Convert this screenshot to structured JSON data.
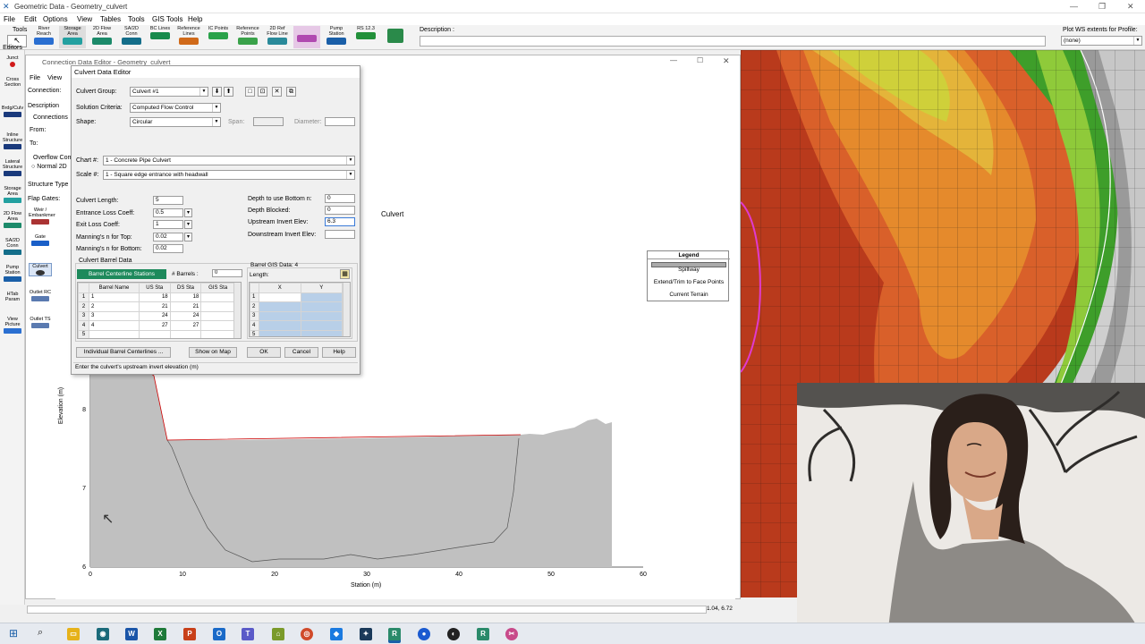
{
  "app": {
    "title": "Geometric Data - Geometry_culvert",
    "menu": [
      "File",
      "Edit",
      "Options",
      "View",
      "Tables",
      "Tools",
      "GIS Tools",
      "Help"
    ]
  },
  "toolbar": {
    "tools_label": "Tools",
    "buttons": [
      "River Reach",
      "Storage Area",
      "2D Flow Area",
      "SA/2D Conn",
      "BC Lines",
      "Reference Lines",
      "IC Points",
      "Reference Points",
      "2D Ref Flow Line",
      "Pump Station",
      "RS 12.3"
    ],
    "description_label": "Description :",
    "plot_ws_label": "Plot WS extents for Profile:",
    "plot_ws_value": "(none)"
  },
  "editors": {
    "label": "Editors",
    "items": [
      "Junct",
      "Cross Section",
      "Brdg/Culv",
      "Inline Structure",
      "Lateral Structure",
      "Storage Area",
      "2D Flow Area",
      "SA/2D Conn",
      "Pump Station",
      "HTab Param",
      "View Picture"
    ]
  },
  "connection_editor": {
    "title": "Connection Data Editor - Geometry_culvert",
    "menu": [
      "File",
      "View"
    ],
    "connection_label": "Connection:",
    "description_label": "Description",
    "connections_label": "Connections",
    "from_label": "From:",
    "to_label": "To:",
    "overflow_label": "Overflow Com",
    "normal_2d_label": "Normal 2D",
    "structure_type_label": "Structure Type",
    "flap_gates_label": "Flap Gates:",
    "side_buttons": [
      "Weir / Embankment",
      "Gate",
      "Culvert",
      "Outlet RC",
      "Outlet TS"
    ],
    "plot_title": "Culvert",
    "y_axis_label": "Elevation (m)",
    "x_axis_label": "Station (m)",
    "x_ticks": [
      "0",
      "10",
      "20",
      "30",
      "40",
      "50",
      "60"
    ],
    "y_ticks": [
      "8",
      "7",
      "6"
    ],
    "coords": "1.04, 6.72"
  },
  "legend": {
    "title": "Legend",
    "items": [
      "Spillway",
      "Extend/Trim to Face Points",
      "Current Terrain"
    ]
  },
  "culvert_dialog": {
    "title": "Culvert Data Editor",
    "culvert_group_label": "Culvert Group:",
    "culvert_group_value": "Culvert #1",
    "solution_criteria_label": "Solution Criteria:",
    "solution_criteria_value": "Computed Flow Control",
    "shape_label": "Shape:",
    "shape_value": "Circular",
    "span_label": "Span:",
    "diameter_label": "Diameter:",
    "chart_label": "Chart #:",
    "chart_value": "1 - Concrete Pipe Culvert",
    "scale_label": "Scale #:",
    "scale_value": "1 - Square edge entrance with headwall",
    "culvert_length_label": "Culvert Length:",
    "culvert_length_value": "5",
    "entrance_loss_label": "Entrance Loss Coeff:",
    "entrance_loss_value": "0.5",
    "exit_loss_label": "Exit Loss Coeff:",
    "exit_loss_value": "1",
    "manning_top_label": "Manning's n for Top:",
    "manning_top_value": "0.02",
    "manning_bottom_label": "Manning's n for Bottom:",
    "manning_bottom_value": "0.02",
    "depth_bottom_n_label": "Depth to use Bottom n:",
    "depth_bottom_n_value": "0",
    "depth_blocked_label": "Depth Blocked:",
    "depth_blocked_value": "0",
    "upstream_invert_label": "Upstream Invert Elev:",
    "upstream_invert_value": "6.3",
    "downstream_invert_label": "Downstream Invert Elev:",
    "downstream_invert_value": "",
    "barrel_data_label": "Culvert Barrel Data",
    "barrel_stations_tab": "Barrel Centerline Stations",
    "num_barrels_label": "# Barrels :",
    "num_barrels_value": "0",
    "barrel_columns": [
      "Barrel Name",
      "US Sta",
      "DS Sta",
      "GIS Sta"
    ],
    "barrel_rows": [
      {
        "n": "1",
        "name": "1",
        "us": "18",
        "ds": "18"
      },
      {
        "n": "2",
        "name": "2",
        "us": "21",
        "ds": "21"
      },
      {
        "n": "3",
        "name": "3",
        "us": "24",
        "ds": "24"
      },
      {
        "n": "4",
        "name": "4",
        "us": "27",
        "ds": "27"
      },
      {
        "n": "5",
        "name": "",
        "us": "",
        "ds": ""
      }
    ],
    "gis_data_label": "Barrel GIS Data: 4",
    "length_label": "Length:",
    "gis_columns": [
      "X",
      "Y"
    ],
    "gis_rows": [
      "1",
      "2",
      "3",
      "4",
      "5"
    ],
    "buttons": {
      "individual": "Individual Barrel Centerlines ...",
      "show_map": "Show on Map",
      "ok": "OK",
      "cancel": "Cancel",
      "help": "Help"
    },
    "status": "Enter the culvert's upstream invert elevation (m)"
  },
  "colors": {
    "accent": "#1a5fa8",
    "tab_green": "#1e8a5c",
    "terrain_fill": "#c0c0c0",
    "spillway_red": "#cc0000"
  }
}
